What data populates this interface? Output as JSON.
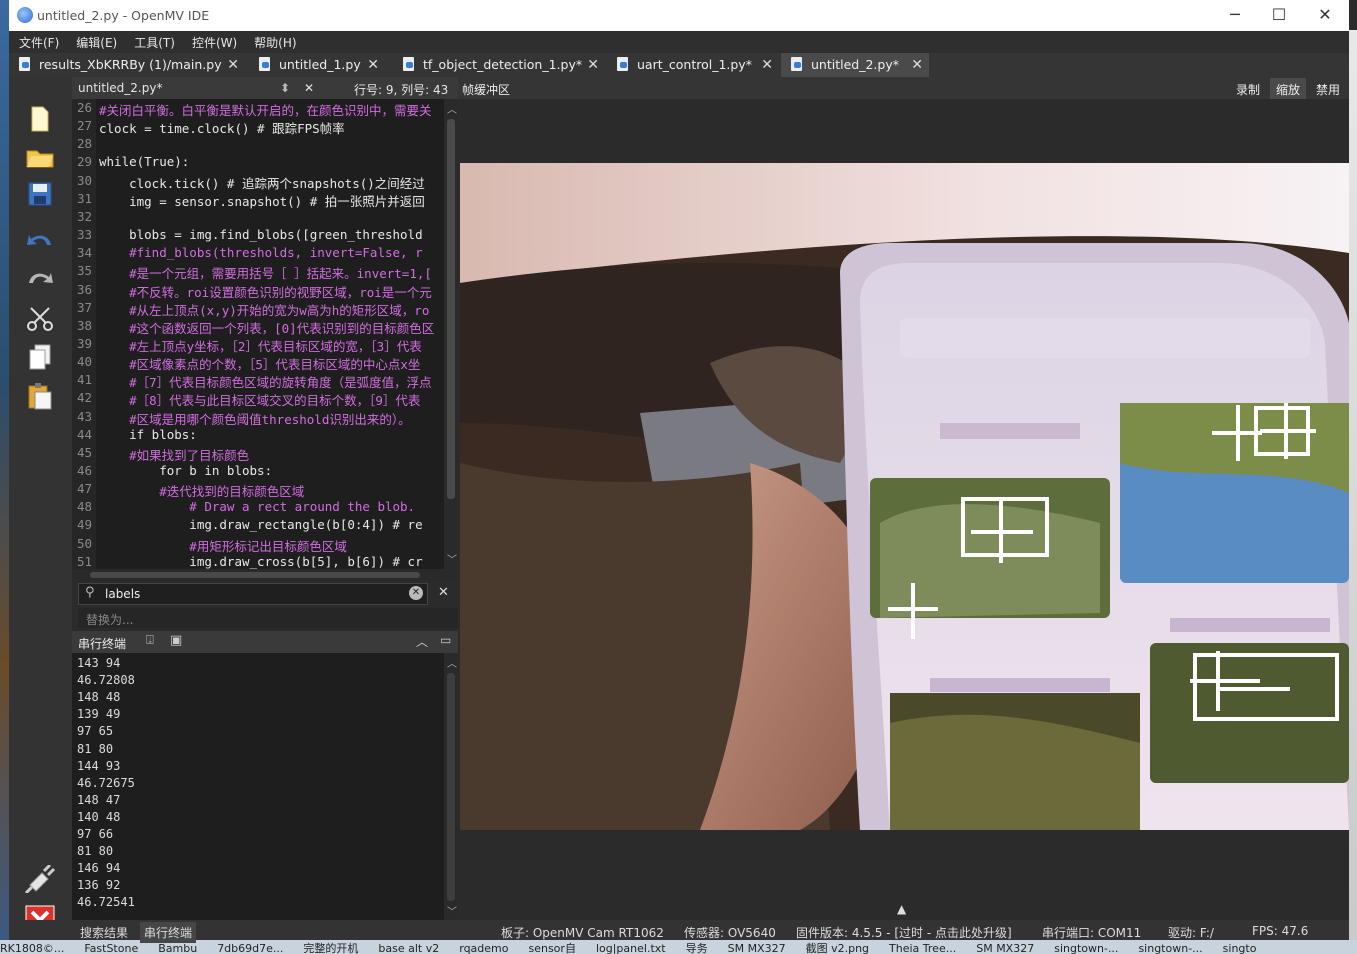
{
  "window": {
    "title": "untitled_2.py - OpenMV IDE",
    "minimize": "─",
    "maximize": "☐",
    "close": "✕"
  },
  "menu": [
    "文件(F)",
    "编辑(E)",
    "工具(T)",
    "控件(W)",
    "帮助(H)"
  ],
  "tabs": [
    {
      "label": "results_XbKRRBy (1)/main.py"
    },
    {
      "label": "untitled_1.py"
    },
    {
      "label": "tf_object_detection_1.py*"
    },
    {
      "label": "uart_control_1.py*"
    },
    {
      "label": "untitled_2.py*"
    }
  ],
  "editor": {
    "filename": "untitled_2.py*",
    "position": "行号: 9, 列号: 43",
    "lines": [
      {
        "n": "26",
        "t": "#关闭白平衡。白平衡是默认开启的，在颜色识别中，需要关"
      },
      {
        "n": "27",
        "t": "clock = time.clock() # 跟踪FPS帧率"
      },
      {
        "n": "28",
        "t": ""
      },
      {
        "n": "29",
        "t": "while(True):"
      },
      {
        "n": "30",
        "t": "    clock.tick() # 追踪两个snapshots()之间经过"
      },
      {
        "n": "31",
        "t": "    img = sensor.snapshot() # 拍一张照片并返回"
      },
      {
        "n": "32",
        "t": ""
      },
      {
        "n": "33",
        "t": "    blobs = img.find_blobs([green_threshold"
      },
      {
        "n": "34",
        "t": "    #find_blobs(thresholds, invert=False, r"
      },
      {
        "n": "35",
        "t": "    #是一个元组，需要用括号［ ］括起来。invert=1,["
      },
      {
        "n": "36",
        "t": "    #不反转。roi设置颜色识别的视野区域，roi是一个元"
      },
      {
        "n": "37",
        "t": "    #从左上顶点(x,y)开始的宽为w高为h的矩形区域，ro"
      },
      {
        "n": "38",
        "t": "    #这个函数返回一个列表，[0]代表识别到的目标颜色区"
      },
      {
        "n": "39",
        "t": "    #左上顶点y坐标，［2］代表目标区域的宽，［3］代表"
      },
      {
        "n": "40",
        "t": "    #区域像素点的个数，［5］代表目标区域的中心点x坐"
      },
      {
        "n": "41",
        "t": "    #［7］代表目标颜色区域的旋转角度（是弧度值，浮点"
      },
      {
        "n": "42",
        "t": "    #［8］代表与此目标区域交叉的目标个数，［9］代表"
      },
      {
        "n": "43",
        "t": "    #区域是用哪个颜色阈值threshold识别出来的）。"
      },
      {
        "n": "44",
        "t": "    if blobs:"
      },
      {
        "n": "45",
        "t": "    #如果找到了目标颜色"
      },
      {
        "n": "46",
        "t": "        for b in blobs:"
      },
      {
        "n": "47",
        "t": "        #迭代找到的目标颜色区域"
      },
      {
        "n": "48",
        "t": "            # Draw a rect around the blob."
      },
      {
        "n": "49",
        "t": "            img.draw_rectangle(b[0:4]) # re"
      },
      {
        "n": "50",
        "t": "            #用矩形标记出目标颜色区域"
      },
      {
        "n": "51",
        "t": "            img.draw_cross(b[5], b[6]) # cr"
      }
    ]
  },
  "find": {
    "value": "labels",
    "replace_placeholder": "替换为..."
  },
  "serial": {
    "title": "串行终端",
    "lines": [
      "143 94",
      "46.72808",
      "148 48",
      "139 49",
      "97 65",
      "81 80",
      "144 93",
      "46.72675",
      "148 47",
      "140 48",
      "97 66",
      "81 80",
      "146 94",
      "136 92",
      "46.72541"
    ]
  },
  "framebuffer": {
    "title": "帧缓冲区",
    "record": "录制",
    "zoom": "缩放",
    "disable": "禁用"
  },
  "status": {
    "search_results": "搜索结果",
    "serial_terminal": "串行终端",
    "board": "板子: OpenMV Cam RT1062",
    "sensor": "传感器: OV5640",
    "firmware": "固件版本: 4.5.5 - [过时 - 点击此处升级]",
    "port": "串行端口: COM11",
    "drive": "驱动: F:/",
    "fps": "FPS:  47.6"
  },
  "taskbar": [
    "RK1808©...",
    "FastStone",
    "Bambu",
    "7db69d7e...",
    "完整的开机",
    "base alt v2",
    "rqademo",
    "sensor自",
    "log|panel.txt",
    "导务",
    "SM MX327",
    "截图 v2.png",
    "Theia Tree...",
    "SM MX327",
    "singtown-...",
    "singtown-...",
    "singto"
  ],
  "icons": {
    "new": "new-file-icon",
    "open": "open-folder-icon",
    "save": "save-icon",
    "undo": "undo-icon",
    "redo": "redo-icon",
    "cut": "cut-icon",
    "copy": "copy-icon",
    "paste": "paste-icon",
    "connect": "connect-plug-icon",
    "stop": "stop-icon"
  },
  "colors": {
    "accent": "#3b7bd6",
    "editor_bg": "#1e1e1e",
    "comment": "#d26de0",
    "keyword": "#6a9bd6",
    "stop": "#d9312b"
  }
}
